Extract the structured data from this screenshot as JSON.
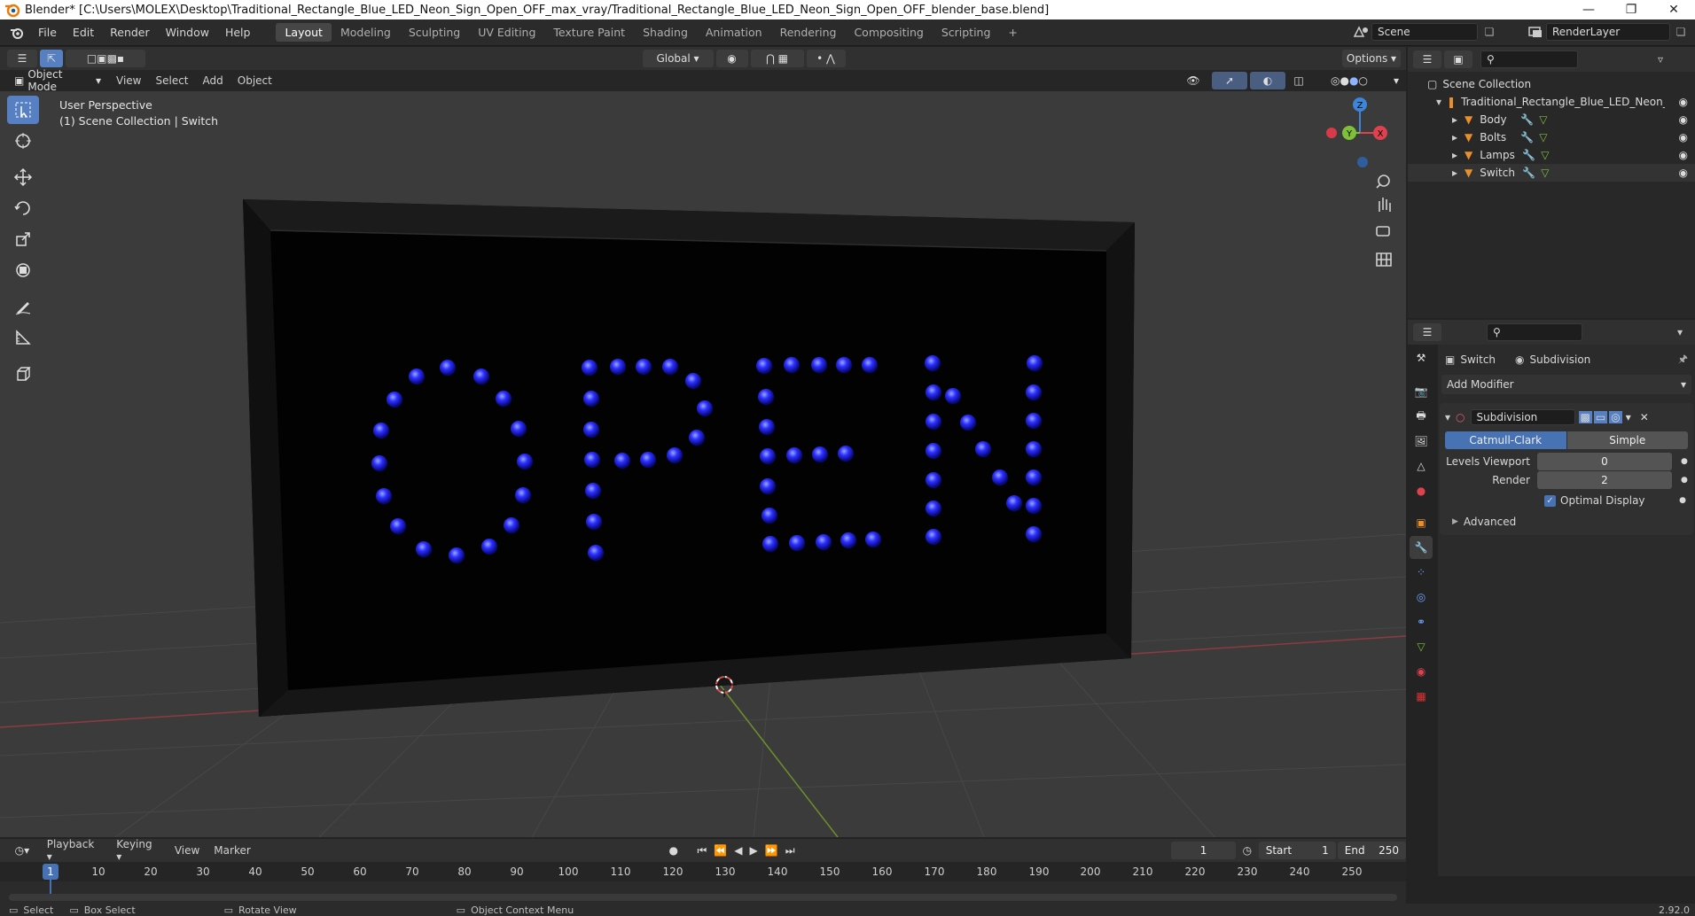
{
  "window": {
    "title": "Blender* [C:\\Users\\MOLEX\\Desktop\\Traditional_Rectangle_Blue_LED_Neon_Sign_Open_OFF_max_vray/Traditional_Rectangle_Blue_LED_Neon_Sign_Open_OFF_blender_base.blend]"
  },
  "menus": [
    "File",
    "Edit",
    "Render",
    "Window",
    "Help"
  ],
  "workspaces": [
    {
      "label": "Layout",
      "active": true
    },
    {
      "label": "Modeling",
      "active": false
    },
    {
      "label": "Sculpting",
      "active": false
    },
    {
      "label": "UV Editing",
      "active": false
    },
    {
      "label": "Texture Paint",
      "active": false
    },
    {
      "label": "Shading",
      "active": false
    },
    {
      "label": "Animation",
      "active": false
    },
    {
      "label": "Rendering",
      "active": false
    },
    {
      "label": "Compositing",
      "active": false
    },
    {
      "label": "Scripting",
      "active": false
    }
  ],
  "scene": {
    "name": "Scene",
    "render_layer": "RenderLayer"
  },
  "viewport_header": {
    "transform_orientation": "Global",
    "options_label": "Options",
    "mode": "Object Mode",
    "menu": [
      "View",
      "Select",
      "Add",
      "Object"
    ]
  },
  "viewport": {
    "perspective": "User Perspective",
    "collection": "(1) Scene Collection | Switch",
    "sign_text": "OPEN",
    "gizmo": {
      "z": "Z",
      "y": "Y",
      "x": "X"
    }
  },
  "outliner": {
    "root": "Scene Collection",
    "collection": "Traditional_Rectangle_Blue_LED_Neon_Sign_",
    "items": [
      "Body",
      "Bolts",
      "Lamps",
      "Switch"
    ]
  },
  "properties": {
    "object_name": "Switch",
    "modifier_name_breadcrumb": "Subdivision",
    "add_modifier": "Add Modifier",
    "modifier": {
      "name": "Subdivision",
      "type_a": "Catmull-Clark",
      "type_b": "Simple",
      "levels_viewport_label": "Levels Viewport",
      "levels_viewport": "0",
      "render_label": "Render",
      "render": "2",
      "optimal_display_label": "Optimal Display",
      "optimal_display": true,
      "advanced_label": "Advanced"
    }
  },
  "timeline": {
    "menu": [
      "Playback",
      "Keying",
      "View",
      "Marker"
    ],
    "current_frame": "1",
    "start_label": "Start",
    "start": "1",
    "end_label": "End",
    "end": "250",
    "ticks": [
      "1",
      "10",
      "20",
      "30",
      "40",
      "50",
      "60",
      "70",
      "80",
      "90",
      "100",
      "110",
      "120",
      "130",
      "140",
      "150",
      "160",
      "170",
      "180",
      "190",
      "200",
      "210",
      "220",
      "230",
      "240",
      "250"
    ]
  },
  "statusbar": {
    "select": "Select",
    "box_select": "Box Select",
    "rotate_view": "Rotate View",
    "context_menu": "Object Context Menu",
    "version": "2.92.0"
  },
  "colors": {
    "accent": "#5680c2",
    "led_blue": "#2a2cff",
    "x_axis": "#e0414f",
    "y_axis": "#7fbf3a",
    "z_axis": "#3d85d8"
  }
}
